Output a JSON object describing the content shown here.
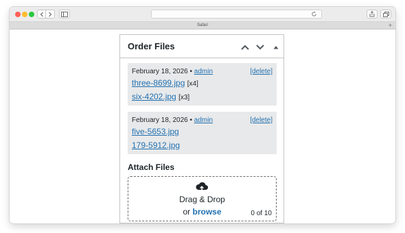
{
  "browser": {
    "tab_title": "Safari",
    "new_tab_glyph": "+"
  },
  "panel": {
    "title": "Order Files",
    "move_up_icon": "chevron-up-icon",
    "move_down_icon": "chevron-down-icon",
    "toggle_icon": "triangle-up-icon"
  },
  "notes": [
    {
      "date": "February 18, 2026",
      "separator": "•",
      "author": "admin",
      "delete_label": "[delete]",
      "files": [
        {
          "name": "three-8699.jpg",
          "count": "[x4]"
        },
        {
          "name": "six-4202.jpg",
          "count": "[x3]"
        }
      ]
    },
    {
      "date": "February 18, 2026",
      "separator": "•",
      "author": "admin",
      "delete_label": "[delete]",
      "files": [
        {
          "name": "five-5653.jpg",
          "count": ""
        },
        {
          "name": "179-5912.jpg",
          "count": ""
        }
      ]
    }
  ],
  "attach": {
    "title": "Attach Files",
    "icon": "cloud-upload-icon",
    "drag_drop_label": "Drag & Drop",
    "or_label": "or",
    "browse_label": "browse",
    "counter": "0 of 10"
  }
}
